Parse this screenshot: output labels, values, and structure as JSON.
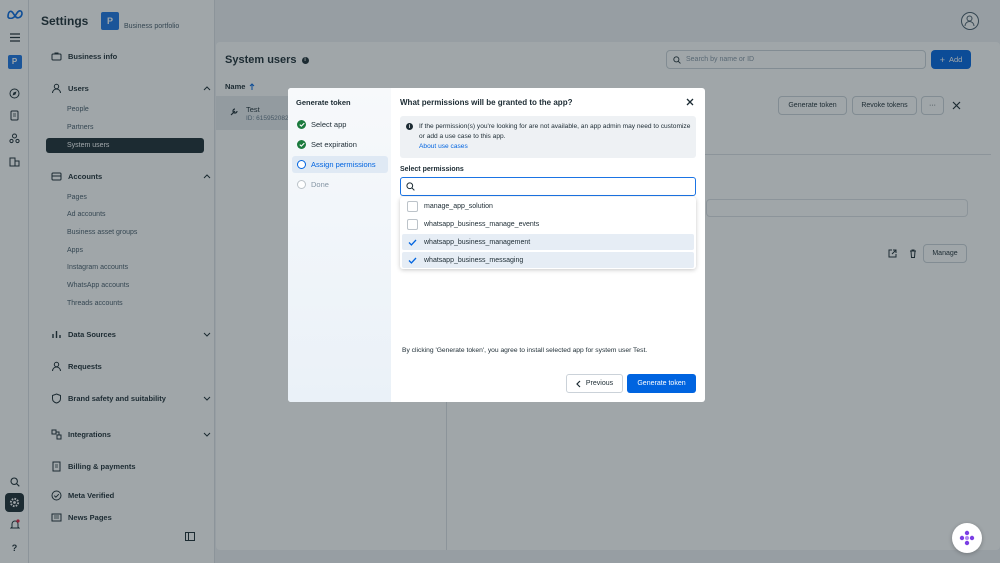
{
  "settings": {
    "title": "Settings",
    "portfolio_initial": "P",
    "portfolio_label": "Business portfolio"
  },
  "sidebar": {
    "business_info": "Business info",
    "users": "Users",
    "users_items": [
      "People",
      "Partners",
      "System users"
    ],
    "accounts": "Accounts",
    "accounts_items": [
      "Pages",
      "Ad accounts",
      "Business asset groups",
      "Apps",
      "Instagram accounts",
      "WhatsApp accounts",
      "Threads accounts"
    ],
    "data_sources": "Data Sources",
    "requests": "Requests",
    "brand_safety": "Brand safety and suitability",
    "integrations": "Integrations",
    "billing": "Billing & payments",
    "meta_verified": "Meta Verified",
    "news_pages": "News Pages"
  },
  "main": {
    "title": "System users",
    "search_placeholder": "Search by name or ID",
    "add_label": "Add",
    "name_header": "Name",
    "user_name": "Test",
    "user_id": "ID: 6159520823",
    "generate_token_label": "Generate token",
    "revoke_tokens_label": "Revoke tokens",
    "more_label": "···",
    "manage_label": "Manage"
  },
  "modal": {
    "steps_title": "Generate token",
    "steps": [
      {
        "label": "Select app",
        "state": "done"
      },
      {
        "label": "Set expiration",
        "state": "done"
      },
      {
        "label": "Assign permissions",
        "state": "current"
      },
      {
        "label": "Done",
        "state": "todo"
      }
    ],
    "title": "What permissions will be granted to the app?",
    "notice_text": "If the permission(s) you're looking for are not available, an app admin may need to customize or add a use case to this app.",
    "notice_link": "About use cases",
    "select_label": "Select permissions",
    "permissions": [
      {
        "name": "manage_app_solution",
        "checked": false
      },
      {
        "name": "whatsapp_business_manage_events",
        "checked": false
      },
      {
        "name": "whatsapp_business_management",
        "checked": true
      },
      {
        "name": "whatsapp_business_messaging",
        "checked": true
      }
    ],
    "disclaimer": "By clicking 'Generate token', you agree to install selected app for system user Test.",
    "previous_label": "Previous",
    "generate_label": "Generate token"
  },
  "colors": {
    "accent": "#0064e0",
    "done_green": "#1c7b3e",
    "selected_row": "#e6edf5"
  }
}
